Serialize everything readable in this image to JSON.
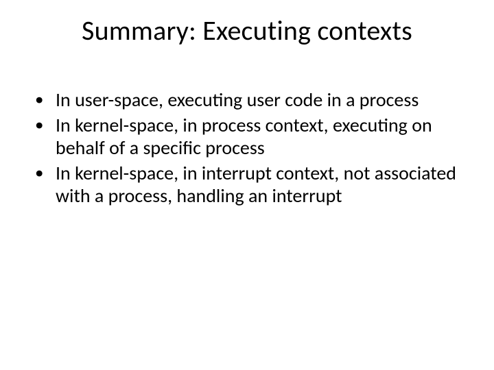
{
  "title": "Summary: Executing contexts",
  "bullets": [
    " In user-space, executing user code in a process",
    " In kernel-space, in process context, executing on behalf of a specific process",
    " In kernel-space, in interrupt context, not associated with a process, handling an interrupt"
  ]
}
